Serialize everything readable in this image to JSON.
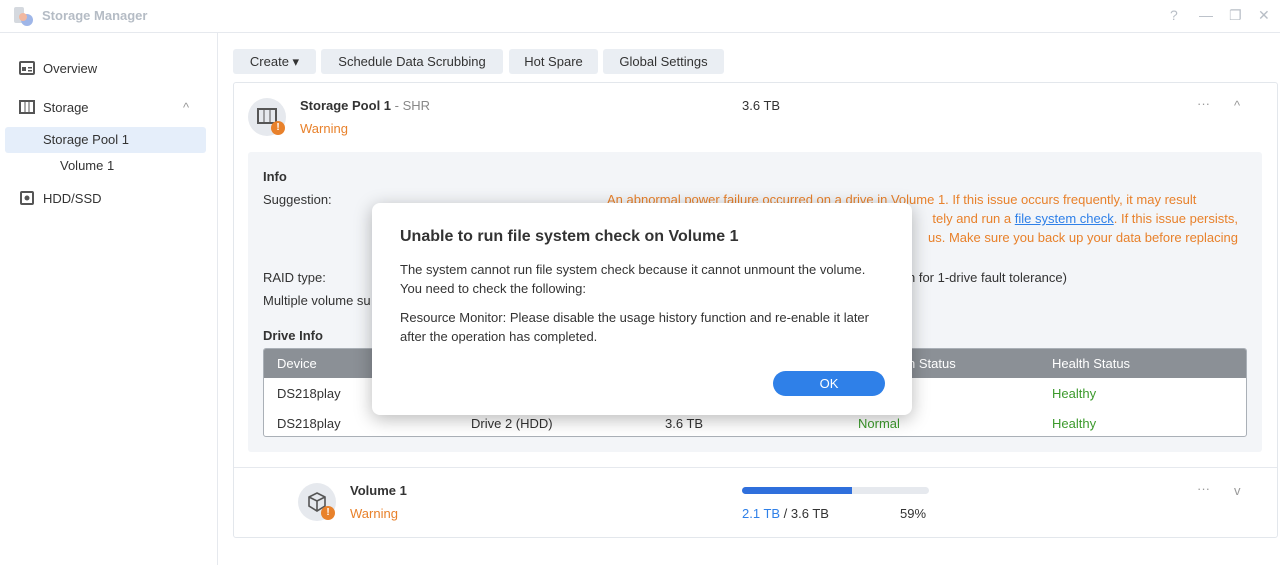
{
  "window": {
    "title": "Storage Manager",
    "help": "?",
    "minimize": "—",
    "restore": "❐",
    "close": "✕"
  },
  "sidebar": {
    "items": [
      {
        "label": "Overview"
      },
      {
        "label": "Storage",
        "chevron": "^"
      },
      {
        "label": "Storage Pool 1"
      },
      {
        "label": "Volume 1"
      },
      {
        "label": "HDD/SSD"
      }
    ]
  },
  "toolbar": {
    "create": "Create ▾",
    "scrub": "Schedule Data Scrubbing",
    "hot_spare": "Hot Spare",
    "global": "Global Settings"
  },
  "pool": {
    "name": "Storage Pool 1",
    "type": " - SHR",
    "status": "Warning",
    "size": "3.6 TB",
    "more": "···",
    "collapse": "^"
  },
  "info": {
    "heading": "Info",
    "suggestion_label": "Suggestion:",
    "suggestion_line1": "An abnormal power failure occurred on a drive in Volume 1. If this issue occurs frequently, it may result",
    "suggestion_line2_pre": "tely and run a ",
    "suggestion_link": "file system check",
    "suggestion_line2_post": ". If this issue persists,",
    "suggestion_line3": "us. Make sure you back up your data before replacing",
    "raid_label": "RAID type:",
    "raid_value": "n for 1-drive fault tolerance)",
    "multi_label": "Multiple volume su"
  },
  "drive_info": {
    "heading": "Drive Info",
    "columns": [
      "Device",
      "n Status",
      "Health Status"
    ],
    "rows": [
      {
        "device": "DS218play",
        "drive": "",
        "size": "",
        "alloc": "",
        "health": "Healthy"
      },
      {
        "device": "DS218play",
        "drive": "Drive 2 (HDD)",
        "size": "3.6 TB",
        "alloc": "Normal",
        "health": "Healthy"
      }
    ]
  },
  "volume": {
    "name": "Volume 1",
    "status": "Warning",
    "used": "2.1 TB",
    "sep": " / ",
    "total": "3.6 TB",
    "percent": "59%",
    "usage_fraction": 0.59,
    "more": "···",
    "expand": "v"
  },
  "modal": {
    "title": "Unable to run file system check on Volume 1",
    "body1": "The system cannot run file system check because it cannot unmount the volume. You need to check the following:",
    "body2": "Resource Monitor: Please disable the usage history function and re-enable it later after the operation has completed.",
    "ok": "OK"
  },
  "colors": {
    "accent": "#2f80e8",
    "warning": "#e8812b",
    "healthy": "#3c9a2c"
  }
}
